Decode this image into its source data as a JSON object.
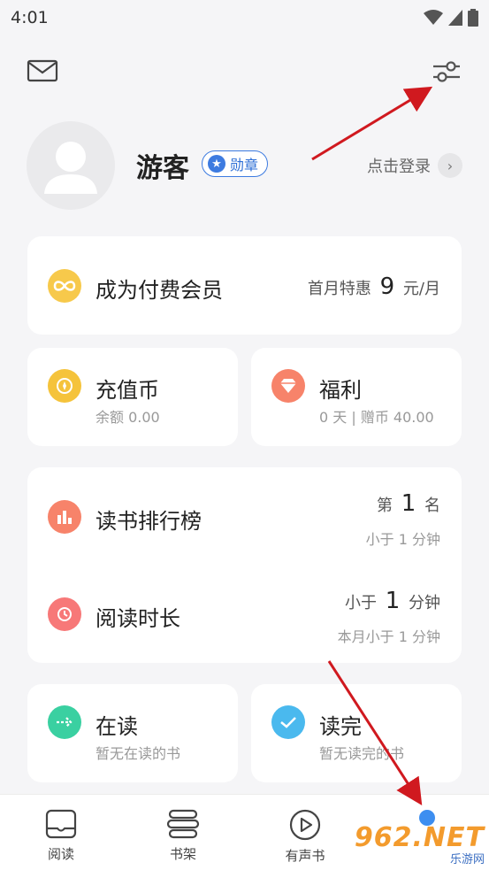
{
  "status": {
    "time": "4:01"
  },
  "profile": {
    "name": "游客",
    "badge": "勋章",
    "login": "点击登录"
  },
  "vip": {
    "title": "成为付费会员",
    "promo_prefix": "首月特惠",
    "promo_price": "9",
    "promo_suffix": "元/月"
  },
  "coins": {
    "title": "充值币",
    "sub": "余额 0.00"
  },
  "welfare": {
    "title": "福利",
    "sub": "0 天 | 赠币 40.00"
  },
  "ranking": {
    "title": "读书排行榜",
    "rank_prefix": "第",
    "rank_value": "1",
    "rank_suffix": "名",
    "sub": "小于 1 分钟"
  },
  "duration": {
    "title": "阅读时长",
    "value_prefix": "小于",
    "value": "1",
    "value_suffix": "分钟",
    "sub": "本月小于 1 分钟"
  },
  "reading": {
    "title": "在读",
    "sub": "暂无在读的书"
  },
  "finished": {
    "title": "读完",
    "sub": "暂无读完的书"
  },
  "nav": {
    "items": [
      {
        "label": "阅读"
      },
      {
        "label": "书架"
      },
      {
        "label": "有声书"
      }
    ]
  },
  "watermark": {
    "main": "962.NET",
    "sub": "乐游网"
  },
  "colors": {
    "accent": "#3d7be0",
    "arrow": "#d0191f",
    "vip": "#f7c94b",
    "welfare": "#f7836a",
    "reading": "#3ad0a1",
    "finished": "#4ab9ee"
  }
}
